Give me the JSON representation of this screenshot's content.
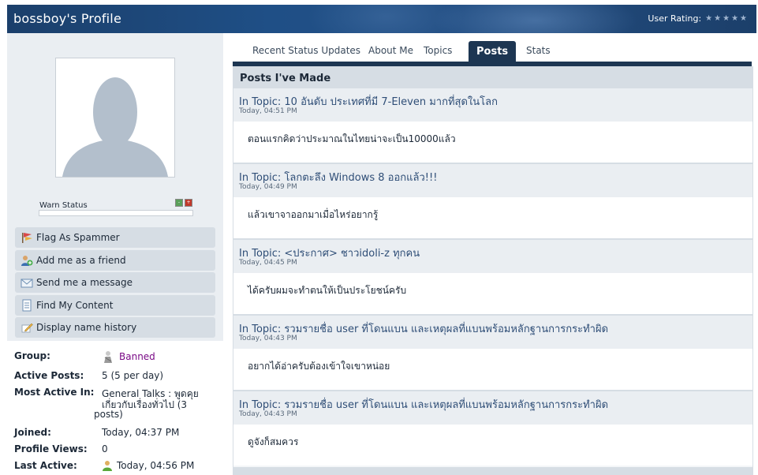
{
  "header": {
    "title": "bossboy's Profile",
    "rating_label": "User Rating:",
    "rating_stars": "★★★★★"
  },
  "profile": {
    "warn_label": "Warn Status",
    "warn_minus": "-",
    "warn_plus": "+"
  },
  "menu": [
    {
      "label": "Flag As Spammer",
      "icon": "flag-icon"
    },
    {
      "label": "Add me as a friend",
      "icon": "user-add-icon"
    },
    {
      "label": "Send me a message",
      "icon": "envelope-icon"
    },
    {
      "label": "Find My Content",
      "icon": "document-icon"
    },
    {
      "label": "Display name history",
      "icon": "pencil-icon"
    }
  ],
  "info": {
    "group_label": "Group:",
    "group_value": "Banned",
    "active_posts_label": "Active Posts:",
    "active_posts_value": "5 (5 per day)",
    "most_active_label": "Most Active In:",
    "most_active_line1": "General Talks : พูดคุย",
    "most_active_line2": "เกี่ยวกับเรื่องทั่วไป (3",
    "most_active_line3": "posts)",
    "joined_label": "Joined:",
    "joined_value": "Today, 04:37 PM",
    "views_label": "Profile Views:",
    "views_value": "0",
    "last_active_label": "Last Active:",
    "last_active_value": "Today, 04:56 PM"
  },
  "tabs": [
    {
      "label": "Recent Status Updates"
    },
    {
      "label": "About Me"
    },
    {
      "label": "Topics"
    },
    {
      "label": "Posts"
    },
    {
      "label": "Stats"
    }
  ],
  "active_tab": "Posts",
  "panel_title": "Posts I've Made",
  "posts": [
    {
      "topic": "In Topic: 10 อันดับ ประเทศที่มี 7-Eleven มากที่สุดในโลก",
      "time": "Today, 04:51 PM",
      "body": "ตอนแรกคิดว่าประมาณในไทยน่าจะเป็น10000แล้ว"
    },
    {
      "topic": "In Topic: โลกตะลึง Windows 8 ออกแล้ว!!!",
      "time": "Today, 04:49 PM",
      "body": "แล้วเขาจาออกมาเมื่อไหร่อยากรู้"
    },
    {
      "topic": "In Topic: <ประกาศ> ชาวidoli-z ทุกคน",
      "time": "Today, 04:45 PM",
      "body": "ได้ครับผมจะทำตนให้เป็นประโยชน์ครับ"
    },
    {
      "topic": "In Topic: รวมรายชื่อ user ที่โดนแบน และเหตุผลที่แบนพร้อมหลักฐานการกระทำผิด",
      "time": "Today, 04:43 PM",
      "body": "อยากได้อ่าครับต้องเข้าใจเขาหน่อย"
    },
    {
      "topic": "In Topic: รวมรายชื่อ user ที่โดนแบน และเหตุผลที่แบนพร้อมหลักฐานการกระทำผิด",
      "time": "Today, 04:43 PM",
      "body": "ดูจังก็สมควร"
    }
  ]
}
